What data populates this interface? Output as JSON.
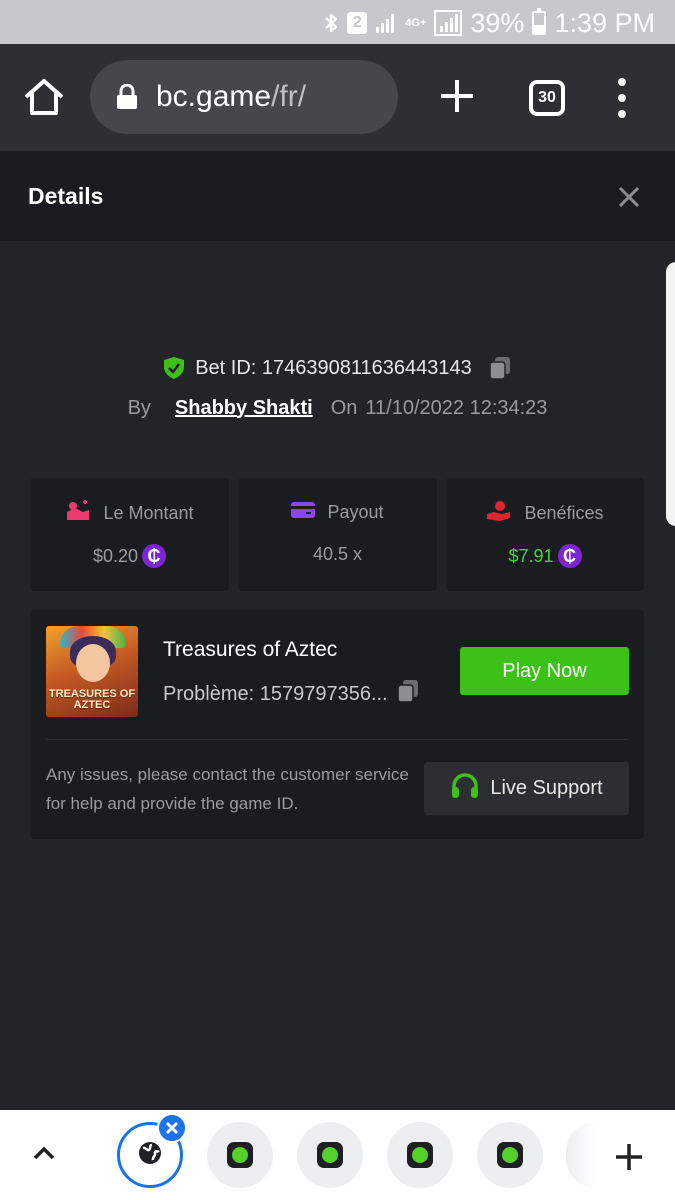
{
  "status_bar": {
    "battery_percent": "39%",
    "time": "1:39 PM",
    "sim_label": "2",
    "network": "4G+",
    "battery_level": 0.39
  },
  "browser": {
    "url_domain": "bc.game",
    "url_path": "/fr/",
    "tab_count": "30",
    "icons": [
      "home-icon",
      "lock-icon",
      "plus-icon",
      "tab-switcher-icon",
      "more-vertical-icon"
    ]
  },
  "details": {
    "title": "Details",
    "close_icon": "close-icon"
  },
  "bet": {
    "id_label": "Bet ID: 1746390811636443143",
    "by_label": "By",
    "user": "Shabby Shakti",
    "on_label": "On",
    "date": "11/10/2022 12:34:23"
  },
  "stats": [
    {
      "label": "Le Montant",
      "value": "$0.20",
      "icon": "bet-amount-icon",
      "icon_color": "#ea3a6e"
    },
    {
      "label": "Payout",
      "value": "40.5 x",
      "icon": "wallet-icon",
      "icon_color": "#8b47e6"
    },
    {
      "label": "Benéfices",
      "value": "$7.91",
      "icon": "profit-hand-icon",
      "icon_color": "#e0252f"
    }
  ],
  "coin_symbol": "₵",
  "game": {
    "name": "Treasures of Aztec",
    "problem": "Problème: 1579797356...",
    "play_label": "Play Now",
    "thumb_text": "TREASURES OF AZTEC",
    "support_text": "Any issues, please contact the customer service for help and provide the game ID.",
    "support_label": "Live Support",
    "accent": "#3bc117"
  },
  "tabstrip": {
    "icons": [
      "chevron-up-icon",
      "globe-icon",
      "close-icon",
      "bc-game-icon",
      "plus-icon"
    ]
  }
}
